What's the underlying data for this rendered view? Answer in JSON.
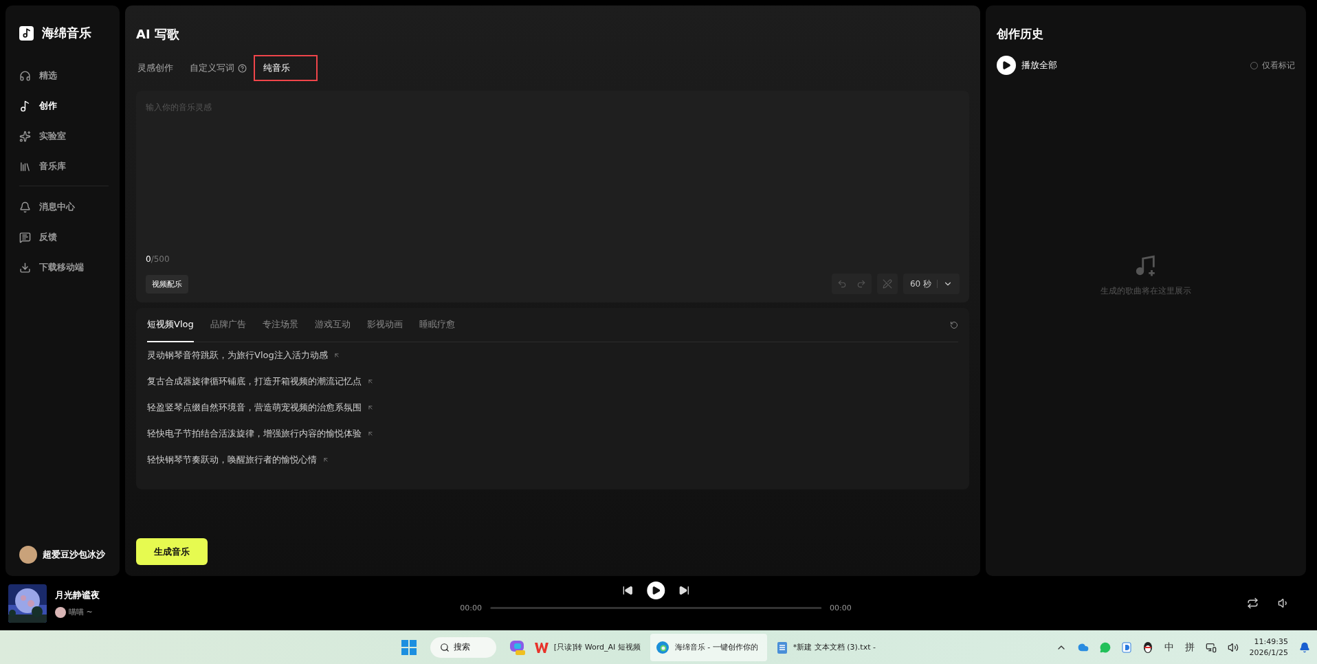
{
  "sidebar": {
    "logo": "海绵音乐",
    "nav": [
      {
        "label": "精选",
        "selected": false
      },
      {
        "label": "创作",
        "selected": true
      },
      {
        "label": "实验室",
        "selected": false
      },
      {
        "label": "音乐库",
        "selected": false
      }
    ],
    "nav_secondary": [
      {
        "label": "消息中心"
      },
      {
        "label": "反馈"
      },
      {
        "label": "下载移动端"
      }
    ],
    "user": {
      "name": "超爱豆沙包冰沙"
    }
  },
  "main": {
    "title": "AI 写歌",
    "mode_tabs": [
      {
        "label": "灵感创作",
        "selected": false,
        "help": false,
        "highlighted": false
      },
      {
        "label": "自定义写词",
        "selected": false,
        "help": true,
        "highlighted": false
      },
      {
        "label": "纯音乐",
        "selected": true,
        "help": false,
        "highlighted": true
      }
    ],
    "prompt": {
      "placeholder": "输入你的音乐灵感",
      "count": "0",
      "max": "/500"
    },
    "video_tag": "视频配乐",
    "duration": "60 秒",
    "scene_tabs": [
      {
        "label": "短视频Vlog",
        "selected": true
      },
      {
        "label": "品牌广告",
        "selected": false
      },
      {
        "label": "专注场景",
        "selected": false
      },
      {
        "label": "游戏互动",
        "selected": false
      },
      {
        "label": "影视动画",
        "selected": false
      },
      {
        "label": "睡眠疗愈",
        "selected": false
      }
    ],
    "suggestions": [
      "灵动钢琴音符跳跃，为旅行Vlog注入活力动感",
      "复古合成器旋律循环铺底，打造开箱视频的潮流记忆点",
      "轻盈竖琴点缀自然环境音，营造萌宠视频的治愈系氛围",
      "轻快电子节拍结合活泼旋律，增强旅行内容的愉悦体验",
      "轻快钢琴节奏跃动，唤醒旅行者的愉悦心情"
    ],
    "generate": "生成音乐"
  },
  "history": {
    "title": "创作历史",
    "play_all": "播放全部",
    "only_marked": {
      "label": "仅看标记",
      "checked": false
    },
    "empty_text": "生成的歌曲将在这里展示"
  },
  "player": {
    "title": "月光静谧夜",
    "artist": "喵喵 ~",
    "time_start": "00:00",
    "time_end": "00:00",
    "level": 0
  },
  "taskbar": {
    "search": "搜索",
    "apps": [
      {
        "kind": "wps",
        "label": "[只读]转 Word_AI 短视频",
        "active": false
      },
      {
        "kind": "edge",
        "label": "海绵音乐 - 一键创作你的",
        "active": true
      },
      {
        "kind": "notepad",
        "label": "*新建 文本文档 (3).txt - ",
        "active": false
      }
    ],
    "ime_lang": "中",
    "ime_mode": "拼",
    "time": "11:49:35",
    "date": "2026/1/25"
  }
}
